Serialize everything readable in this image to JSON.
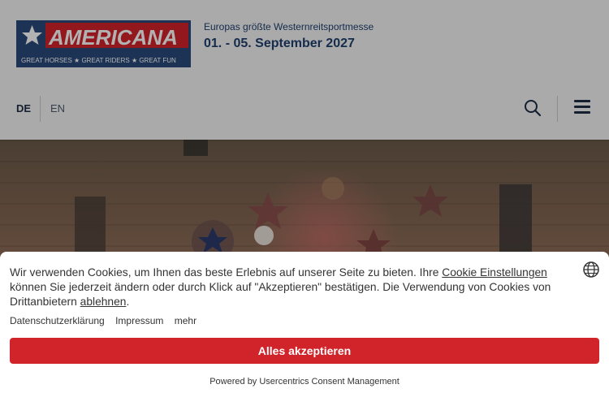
{
  "header": {
    "logo_text": "AMERICANA",
    "logo_slogan": "GREAT HORSES ★ GREAT RIDERS ★ GREAT FUN",
    "tagline": "Europas größte Westernreitsportmesse",
    "dates": "01. - 05. September 2027",
    "lang_de": "DE",
    "lang_en": "EN",
    "search_icon": "search-icon",
    "menu_icon": "hamburger-menu-icon"
  },
  "colors": {
    "brand_red": "#d1232a",
    "brand_blue": "#2a4a7a",
    "text_dark": "#333333"
  },
  "cookie": {
    "text_before_link": "Wir verwenden Cookies, um Ihnen das beste Erlebnis auf unserer Seite zu bieten. Ihre ",
    "settings_link": "Cookie Einstellungen",
    "text_middle": " können Sie jederzeit ändern oder durch Klick auf \"Akzeptieren\" bestätigen. Die Verwendung von Cookies von Drittanbietern ",
    "decline_link": "ablehnen",
    "text_end": ".",
    "privacy_link": "Datenschutzerklärung",
    "imprint_link": "Impressum",
    "more_link": "mehr",
    "accept_label": "Alles akzeptieren",
    "powered_by": "Powered by Usercentrics Consent Management",
    "language_icon": "globe-icon"
  }
}
